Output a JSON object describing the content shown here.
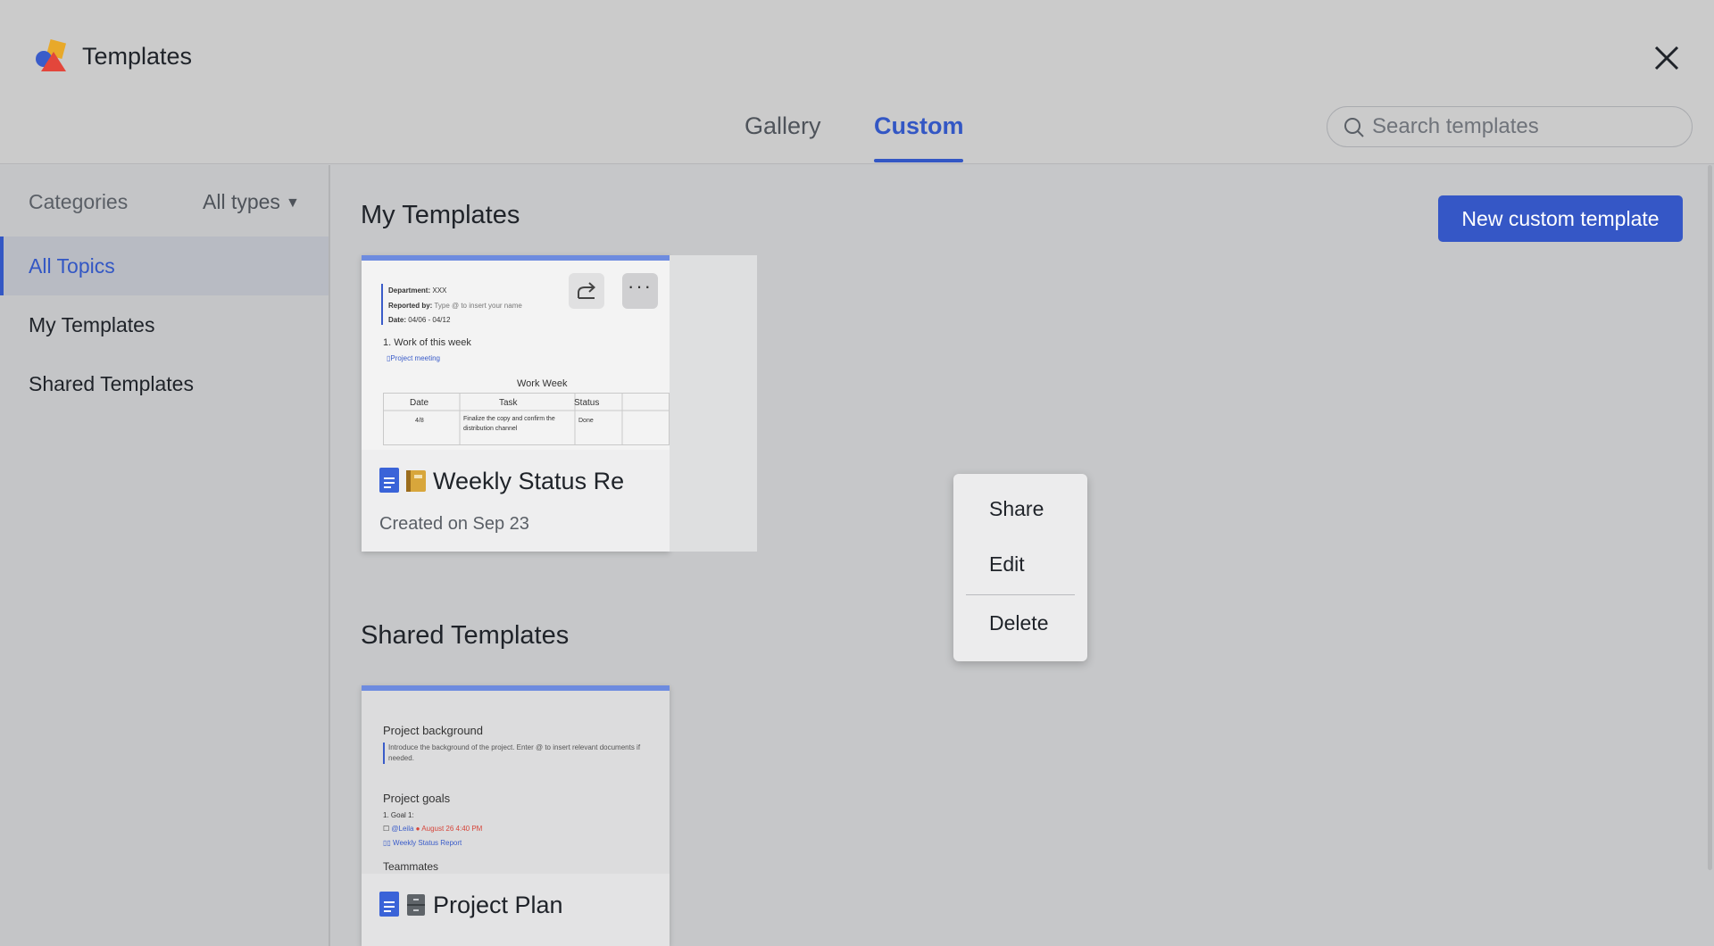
{
  "header": {
    "app_title": "Templates",
    "tabs": [
      {
        "label": "Gallery",
        "active": false
      },
      {
        "label": "Custom",
        "active": true
      }
    ],
    "search": {
      "placeholder": "Search templates"
    }
  },
  "sidebar": {
    "categories_label": "Categories",
    "types_dropdown": "All types",
    "items": [
      {
        "label": "All Topics",
        "active": true
      },
      {
        "label": "My Templates",
        "active": false
      },
      {
        "label": "Shared Templates",
        "active": false
      }
    ]
  },
  "main": {
    "my_templates": {
      "title": "My Templates",
      "new_button": "New custom template",
      "card": {
        "title": "Weekly Status Re",
        "subtitle": "Created on Sep 23",
        "preview": {
          "department": "Department:",
          "department_value": "XXX",
          "reported_by": "Reported by:",
          "reported_by_value": "Type @ to insert your name",
          "date": "Date:",
          "date_value": "04/06 - 04/12",
          "section": "1. Work of this week",
          "link": "Project meeting",
          "table_title": "Work Week",
          "columns": [
            "Date",
            "Task",
            "Status"
          ],
          "row": [
            "4/8",
            "Finalize the copy and confirm the",
            "distribution channel",
            "Done"
          ]
        }
      },
      "menu": [
        "Share",
        "Edit",
        "Delete"
      ]
    },
    "shared_templates": {
      "title": "Shared Templates",
      "card": {
        "title": "Project Plan",
        "preview": {
          "h1": "Project background",
          "p1a": "Introduce the background of the project. Enter @ to insert relevant documents if",
          "p1b": "needed.",
          "h2": "Project goals",
          "goal": "1.  Goal 1:",
          "mention": "@Leila",
          "due": "August 26 4:40 PM",
          "link": "Weekly Status Report",
          "h3": "Teammates"
        }
      }
    }
  },
  "colors": {
    "accent": "#3357c4",
    "button": "#3557c6",
    "overlay_bg": "#c6c7c9"
  },
  "icons": [
    "app-logo-icon",
    "close-icon",
    "search-icon",
    "share-icon",
    "more-icon",
    "doc-icon",
    "notebook-icon",
    "file-cabinet-icon"
  ]
}
